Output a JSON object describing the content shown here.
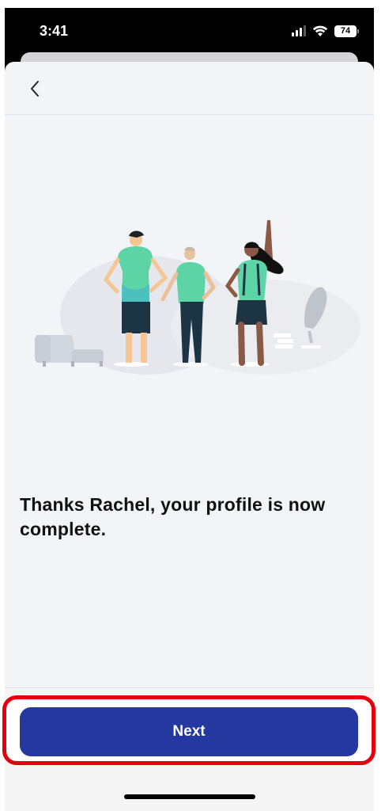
{
  "status_bar": {
    "time": "3:41",
    "battery_level": "74"
  },
  "message": "Thanks Rachel, your profile is now complete.",
  "next_button": {
    "label": "Next"
  },
  "colors": {
    "accent": "#2438a0",
    "highlight": "#e3000f",
    "background": "#f3f4f8",
    "teal": "#5dd4a6"
  },
  "icons": [
    "cellular-signal-icon",
    "wifi-icon",
    "battery-icon",
    "back-chevron-icon"
  ]
}
